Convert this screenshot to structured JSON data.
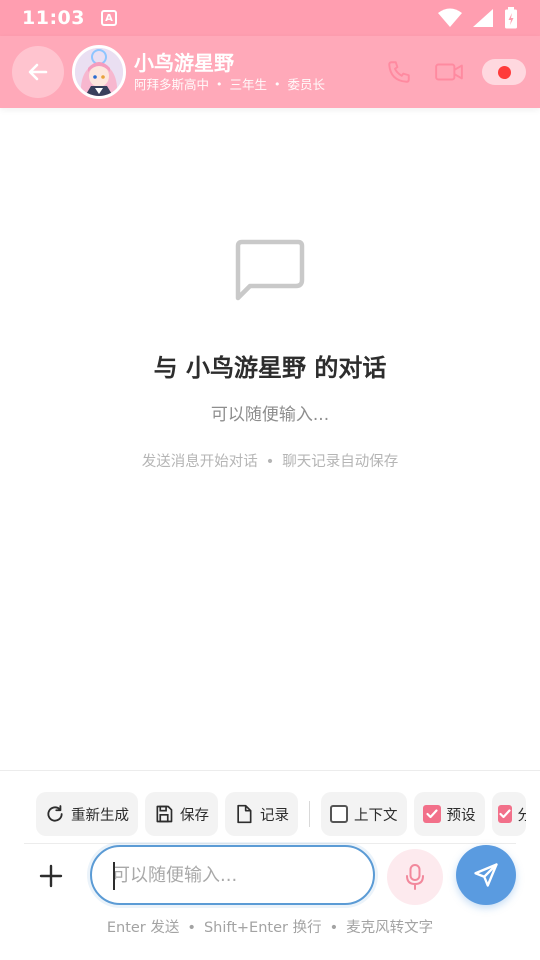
{
  "status_bar": {
    "time": "11:03",
    "app_icon_letter": "A"
  },
  "header": {
    "title": "小鸟游星野",
    "subtitle": {
      "school": "阿拜多斯高中",
      "grade": "三年生",
      "role": "委员长",
      "separator": "•"
    }
  },
  "empty_state": {
    "title": "与 小鸟游星野 的对话",
    "placeholder": "可以随便输入...",
    "hint_left": "发送消息开始对话",
    "hint_right": "聊天记录自动保存",
    "separator": "•"
  },
  "toolbar": {
    "regenerate_label": "重新生成",
    "save_label": "保存",
    "record_label": "记录",
    "context_label": "上下文",
    "context_checked": false,
    "preset_label": "预设",
    "preset_checked": true,
    "extra_label": "分",
    "extra_checked": true
  },
  "input": {
    "placeholder": "可以随便输入...",
    "value": ""
  },
  "input_hint": {
    "send": "Enter 发送",
    "newline": "Shift+Enter 换行",
    "mic": "麦克风转文字",
    "separator": "•"
  },
  "colors": {
    "header": "#ffa9b9",
    "status_bar": "#ff9eb0",
    "send_button": "#5a9be0",
    "mic_button_bg": "#fdeaee",
    "checkbox_checked": "#f2708a",
    "record_dot": "#ff3b3b"
  },
  "icons": {
    "back": "arrow-left-icon",
    "phone": "phone-icon",
    "video": "video-camera-icon",
    "record": "record-dot-icon",
    "empty": "chat-bubble-icon",
    "regenerate": "refresh-icon",
    "save": "floppy-disk-icon",
    "record_file": "document-icon",
    "add": "plus-icon",
    "mic": "microphone-icon",
    "send": "paper-plane-icon"
  }
}
